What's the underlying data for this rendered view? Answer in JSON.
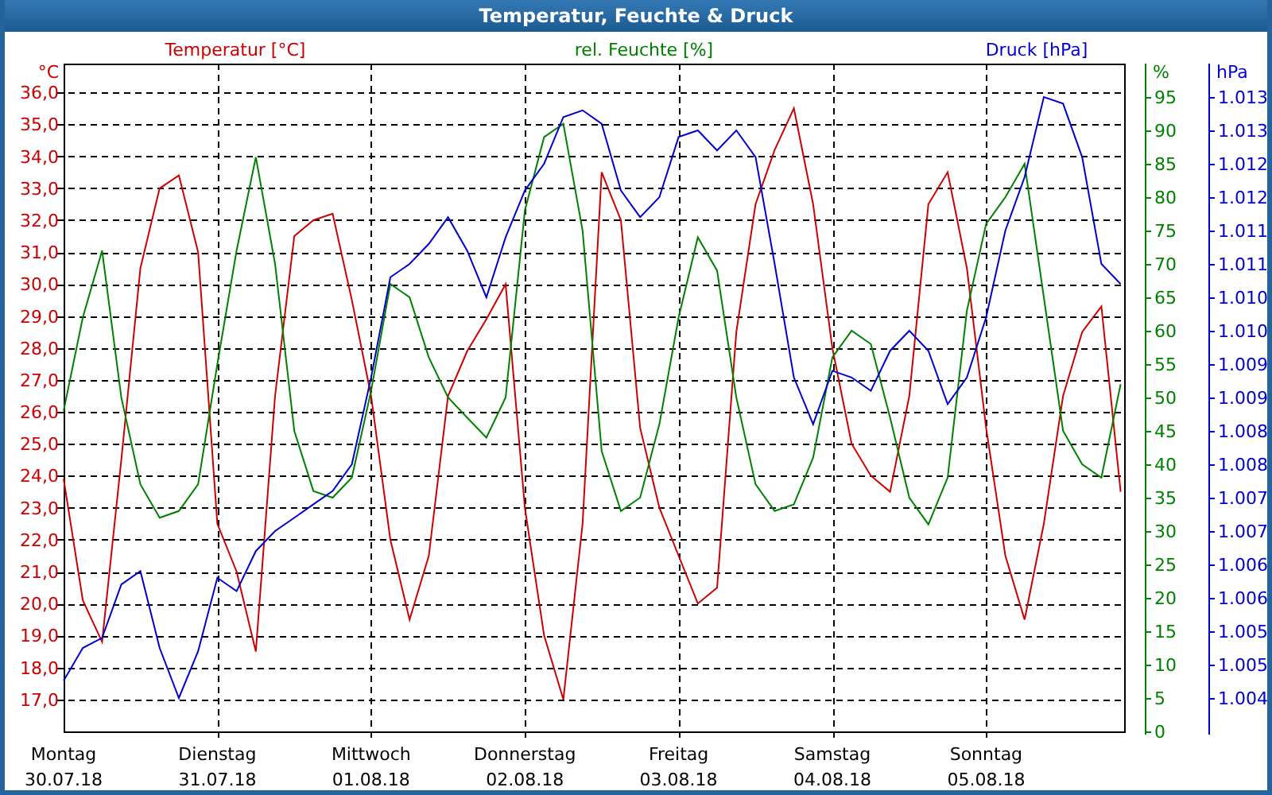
{
  "window": {
    "title": "Temperatur, Feuchte & Druck"
  },
  "charts": [
    {
      "chart_data": {
        "type": "line",
        "ylabel": "°C",
        "categories": [
          "Montag",
          null,
          null,
          null,
          null,
          null,
          null,
          null,
          "Dienstag",
          null,
          null,
          null,
          null,
          null,
          null,
          null,
          "Mittwoch",
          null,
          null,
          null,
          null,
          null,
          null,
          null,
          "Donnerstag",
          null,
          null,
          null,
          null,
          null,
          null,
          null,
          "Freitag",
          null,
          null,
          null,
          null,
          null,
          null,
          null,
          "Samstag",
          null,
          null,
          null,
          null,
          null,
          null,
          null,
          "Sonntag",
          null,
          null,
          null,
          null,
          null,
          null,
          null
        ],
        "ylim": [
          16,
          36.9
        ],
        "yticks": [
          {
            "value": 17,
            "label": "17,0"
          },
          {
            "value": 18,
            "label": "18,0"
          },
          {
            "value": 19,
            "label": "19,0"
          },
          {
            "value": 20,
            "label": "20,0"
          },
          {
            "value": 21,
            "label": "21,0"
          },
          {
            "value": 22,
            "label": "22,0"
          },
          {
            "value": 23,
            "label": "23,0"
          },
          {
            "value": 24,
            "label": "24,0"
          },
          {
            "value": 25,
            "label": "25,0"
          },
          {
            "value": 26,
            "label": "26,0"
          },
          {
            "value": 27,
            "label": "27,0"
          },
          {
            "value": 28,
            "label": "28,0"
          },
          {
            "value": 29,
            "label": "29,0"
          },
          {
            "value": 30,
            "label": "30,0"
          },
          {
            "value": 31,
            "label": "31,0"
          },
          {
            "value": 32,
            "label": "32,0"
          },
          {
            "value": 33,
            "label": "33,0"
          },
          {
            "value": 34,
            "label": "34,0"
          },
          {
            "value": 35,
            "label": "35,0"
          },
          {
            "value": 36,
            "label": "36,0"
          }
        ],
        "series": [
          {
            "name": "Temperatur [°C]",
            "color": "#cc0000",
            "values": [
              23.9,
              20.1,
              18.8,
              24.5,
              30.5,
              33.0,
              33.4,
              31.0,
              22.5,
              21.0,
              18.5,
              26.5,
              31.5,
              32.0,
              32.2,
              29.5,
              26.5,
              22.0,
              19.5,
              21.5,
              26.5,
              27.9,
              28.9,
              30.0,
              23.0,
              19.0,
              17.0,
              22.5,
              33.5,
              32.0,
              25.5,
              23.0,
              21.5,
              20.0,
              20.5,
              28.5,
              32.5,
              34.2,
              35.5,
              32.5,
              28.0,
              25.0,
              24.0,
              23.5,
              26.5,
              32.5,
              33.5,
              30.5,
              25.5,
              21.5,
              19.5,
              22.5,
              26.5,
              28.5,
              29.3,
              23.5
            ]
          }
        ]
      }
    },
    {
      "chart_data": {
        "type": "line",
        "ylabel": "%",
        "categories": [
          null,
          null,
          null,
          null,
          null,
          null,
          null,
          null,
          null,
          null,
          null,
          null,
          null,
          null,
          null,
          null,
          null,
          null,
          null,
          null,
          null,
          null,
          null,
          null,
          null,
          null,
          null,
          null,
          null,
          null,
          null,
          null,
          null,
          null,
          null,
          null,
          null,
          null,
          null,
          null,
          null,
          null,
          null,
          null,
          null,
          null,
          null,
          null,
          null,
          null,
          null,
          null,
          null,
          null,
          null,
          null
        ],
        "ylim": [
          0,
          100
        ],
        "yticks": [
          {
            "value": 0,
            "label": "0"
          },
          {
            "value": 5,
            "label": "5"
          },
          {
            "value": 10,
            "label": "10"
          },
          {
            "value": 15,
            "label": "15"
          },
          {
            "value": 20,
            "label": "20"
          },
          {
            "value": 25,
            "label": "25"
          },
          {
            "value": 30,
            "label": "30"
          },
          {
            "value": 35,
            "label": "35"
          },
          {
            "value": 40,
            "label": "40"
          },
          {
            "value": 45,
            "label": "45"
          },
          {
            "value": 50,
            "label": "50"
          },
          {
            "value": 55,
            "label": "55"
          },
          {
            "value": 60,
            "label": "60"
          },
          {
            "value": 65,
            "label": "65"
          },
          {
            "value": 70,
            "label": "70"
          },
          {
            "value": 75,
            "label": "75"
          },
          {
            "value": 80,
            "label": "80"
          },
          {
            "value": 85,
            "label": "85"
          },
          {
            "value": 90,
            "label": "90"
          },
          {
            "value": 95,
            "label": "95"
          }
        ],
        "series": [
          {
            "name": "rel. Feuchte [%]",
            "color": "#008000",
            "values": [
              48,
              62,
              72,
              50,
              37,
              32,
              33,
              37,
              55,
              72,
              86,
              70,
              45,
              36,
              35,
              38,
              51,
              67,
              65,
              56,
              50,
              47,
              44,
              50,
              78,
              89,
              91,
              75,
              42,
              33,
              35,
              46,
              62,
              74,
              69,
              50,
              37,
              33,
              34,
              41,
              56,
              60,
              58,
              47,
              35,
              31,
              38,
              63,
              76,
              80,
              85,
              65,
              45,
              40,
              38,
              52
            ]
          }
        ]
      }
    },
    {
      "chart_data": {
        "type": "line",
        "ylabel": "hPa",
        "categories": [
          null,
          null,
          null,
          null,
          null,
          null,
          null,
          null,
          null,
          null,
          null,
          null,
          null,
          null,
          null,
          null,
          null,
          null,
          null,
          null,
          null,
          null,
          null,
          null,
          null,
          null,
          null,
          null,
          null,
          null,
          null,
          null,
          null,
          null,
          null,
          null,
          null,
          null,
          null,
          null,
          null,
          null,
          null,
          null,
          null,
          null,
          null,
          null,
          null,
          null,
          null,
          null,
          null,
          null,
          null,
          null
        ],
        "ylim": [
          1003.7,
          1013.7
        ],
        "yticks": [
          {
            "value": 1004.2,
            "label": "1.004"
          },
          {
            "value": 1004.7,
            "label": "1.005"
          },
          {
            "value": 1005.2,
            "label": "1.005"
          },
          {
            "value": 1005.7,
            "label": "1.006"
          },
          {
            "value": 1006.2,
            "label": "1.006"
          },
          {
            "value": 1006.7,
            "label": "1.007"
          },
          {
            "value": 1007.2,
            "label": "1.007"
          },
          {
            "value": 1007.7,
            "label": "1.008"
          },
          {
            "value": 1008.2,
            "label": "1.008"
          },
          {
            "value": 1008.7,
            "label": "1.009"
          },
          {
            "value": 1009.2,
            "label": "1.009"
          },
          {
            "value": 1009.7,
            "label": "1.010"
          },
          {
            "value": 1010.2,
            "label": "1.010"
          },
          {
            "value": 1010.7,
            "label": "1.011"
          },
          {
            "value": 1011.2,
            "label": "1.011"
          },
          {
            "value": 1011.7,
            "label": "1.012"
          },
          {
            "value": 1012.2,
            "label": "1.012"
          },
          {
            "value": 1012.7,
            "label": "1.013"
          },
          {
            "value": 1013.2,
            "label": "1.013"
          }
        ],
        "series": [
          {
            "name": "Druck [hPa]",
            "color": "#0000cc",
            "values": [
              1004.46,
              1004.95,
              1005.1,
              1005.9,
              1006.1,
              1004.95,
              1004.2,
              1004.9,
              1006.0,
              1005.8,
              1006.4,
              1006.7,
              1006.9,
              1007.1,
              1007.3,
              1007.7,
              1009.0,
              1010.5,
              1010.7,
              1011.0,
              1011.4,
              1010.9,
              1010.2,
              1011.1,
              1011.8,
              1012.2,
              1012.9,
              1013.0,
              1012.8,
              1011.8,
              1011.4,
              1011.7,
              1012.6,
              1012.7,
              1012.4,
              1012.7,
              1012.3,
              1010.7,
              1009.0,
              1008.3,
              1009.1,
              1009.0,
              1008.8,
              1009.4,
              1009.7,
              1009.4,
              1008.6,
              1009.0,
              1009.9,
              1011.2,
              1012.0,
              1013.2,
              1013.1,
              1012.3,
              1010.7,
              1010.4
            ]
          }
        ]
      }
    }
  ],
  "dates": [
    "30.07.18",
    "31.07.18",
    "01.08.18",
    "02.08.18",
    "03.08.18",
    "04.08.18",
    "05.08.18"
  ]
}
